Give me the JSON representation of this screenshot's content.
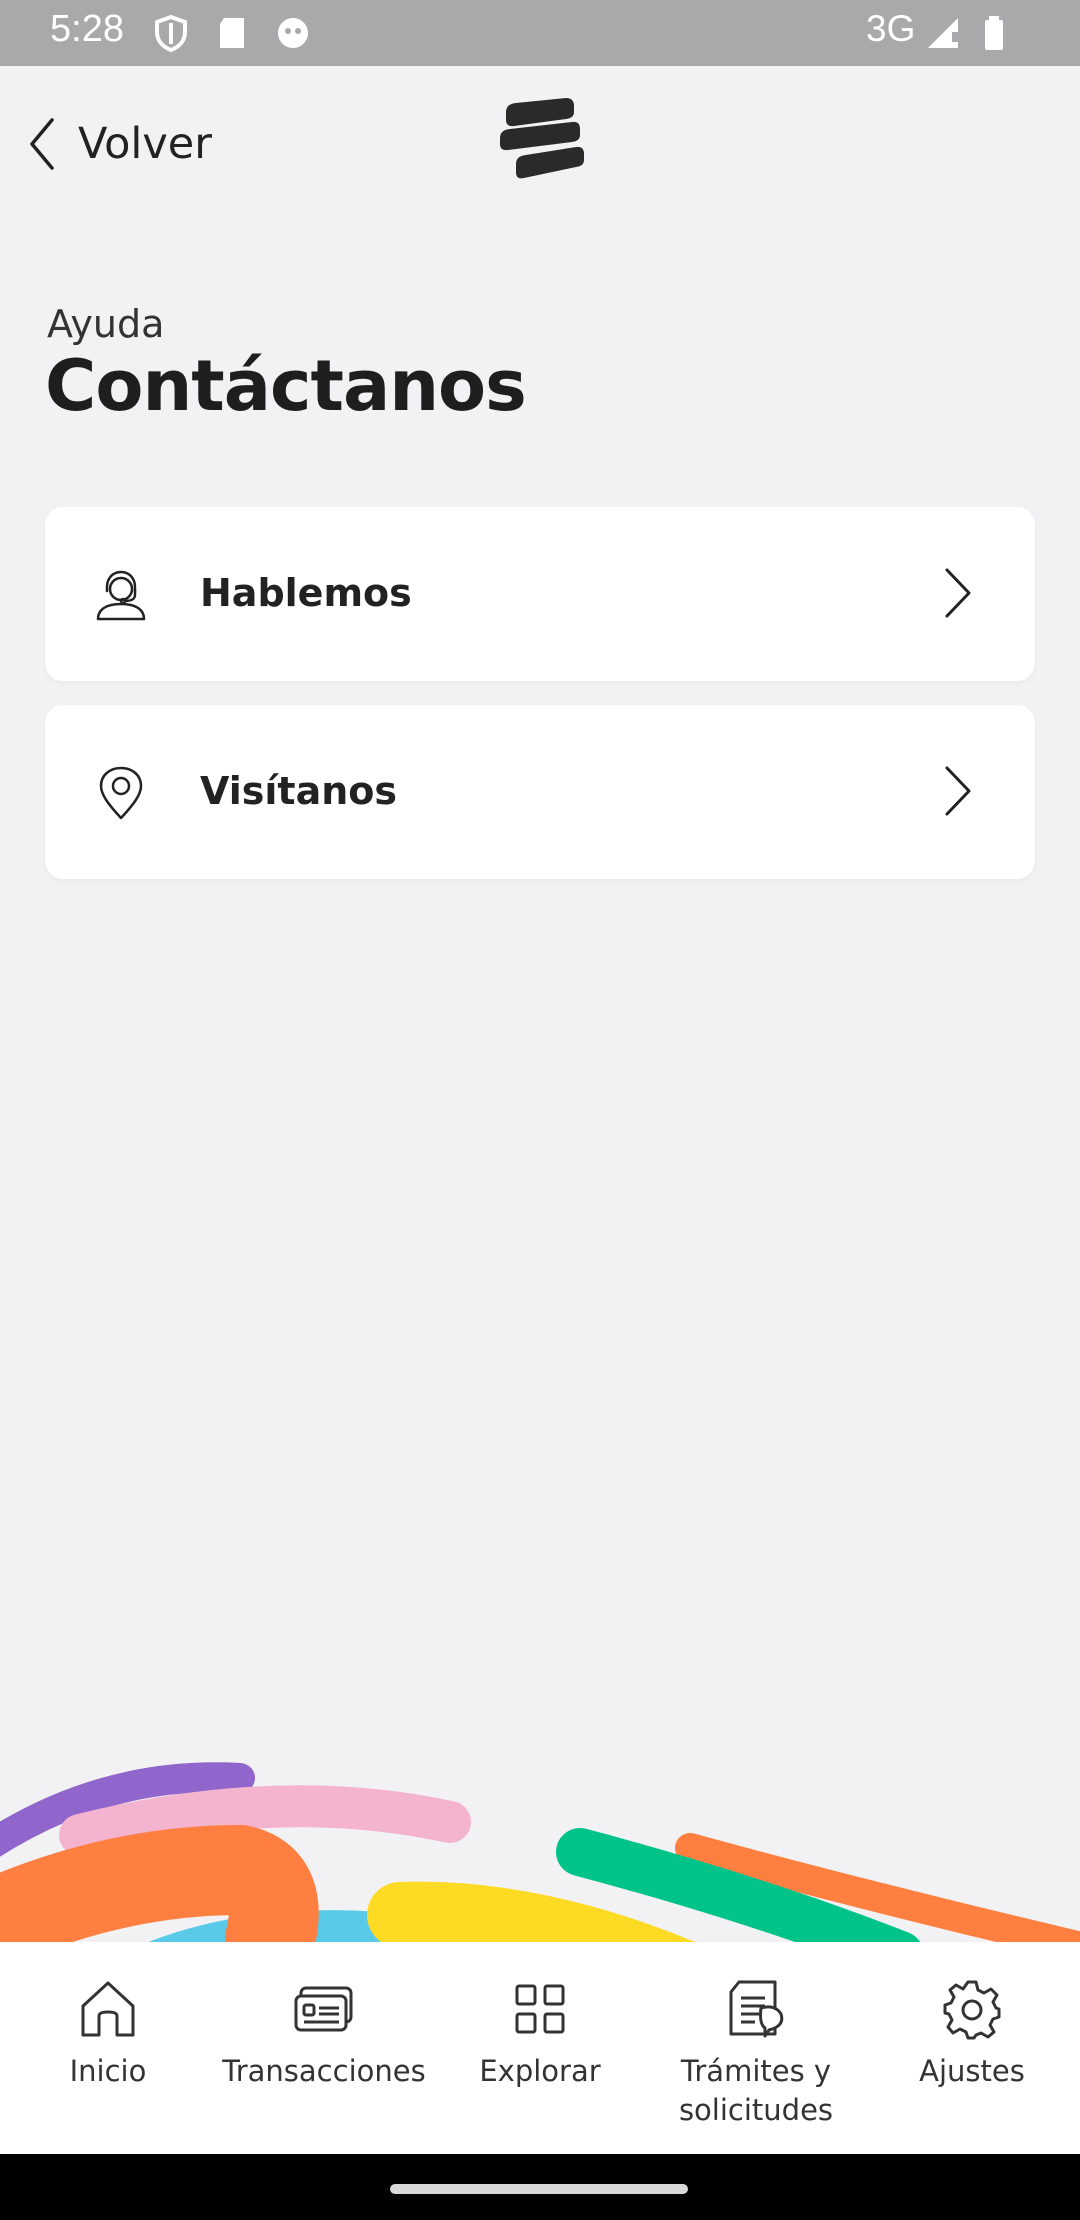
{
  "status_bar": {
    "time": "5:28",
    "network": "3G"
  },
  "header": {
    "back_label": "Volver"
  },
  "page": {
    "breadcrumb": "Ayuda",
    "title": "Contáctanos"
  },
  "options": [
    {
      "label": "Hablemos",
      "icon": "headset-agent-icon"
    },
    {
      "label": "Visítanos",
      "icon": "location-pin-icon"
    }
  ],
  "bottom_nav": [
    {
      "label": "Inicio",
      "icon": "home-icon"
    },
    {
      "label": "Transacciones",
      "icon": "card-transactions-icon"
    },
    {
      "label": "Explorar",
      "icon": "grid-icon"
    },
    {
      "label": "Trámites y solicitudes",
      "icon": "document-icon"
    },
    {
      "label": "Ajustes",
      "icon": "gear-icon"
    }
  ],
  "colors": {
    "background": "#f2f2f4",
    "wave_purple": "#9166cc",
    "wave_pink": "#f4b3cf",
    "wave_orange": "#ff7f41",
    "wave_blue": "#59cbe8",
    "wave_yellow": "#fdda24",
    "wave_green": "#00c389"
  }
}
